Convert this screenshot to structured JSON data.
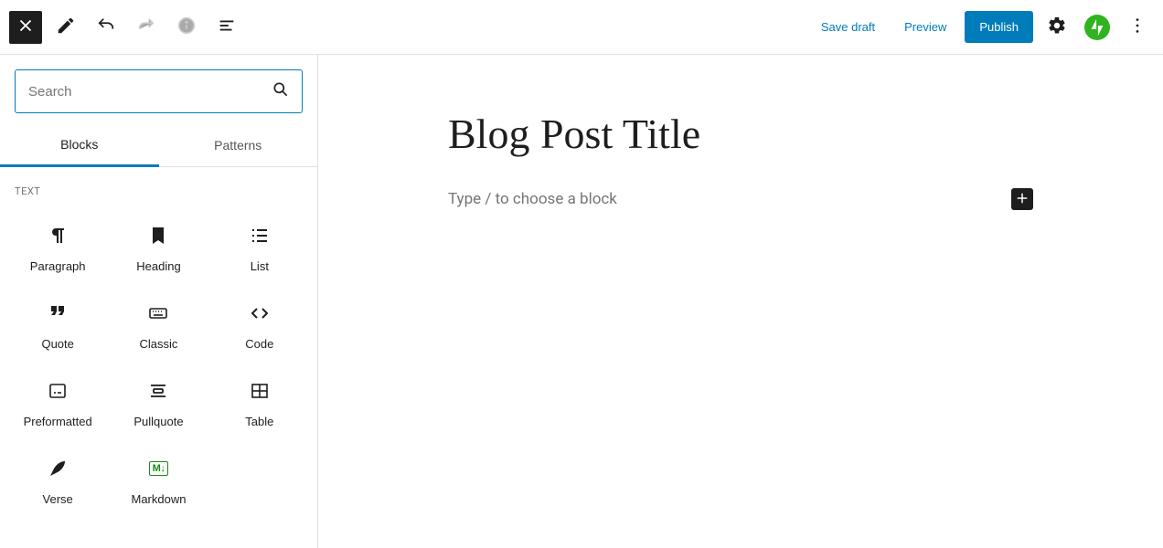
{
  "toolbar": {
    "save_draft": "Save draft",
    "preview": "Preview",
    "publish": "Publish"
  },
  "inserter": {
    "search_placeholder": "Search",
    "tabs": {
      "blocks": "Blocks",
      "patterns": "Patterns"
    },
    "category_text": "TEXT",
    "blocks": {
      "paragraph": "Paragraph",
      "heading": "Heading",
      "list": "List",
      "quote": "Quote",
      "classic": "Classic",
      "code": "Code",
      "preformatted": "Preformatted",
      "pullquote": "Pullquote",
      "table": "Table",
      "verse": "Verse",
      "markdown": "Markdown",
      "markdown_badge": "M↓"
    }
  },
  "editor": {
    "title": "Blog Post Title",
    "prompt": "Type / to choose a block"
  }
}
